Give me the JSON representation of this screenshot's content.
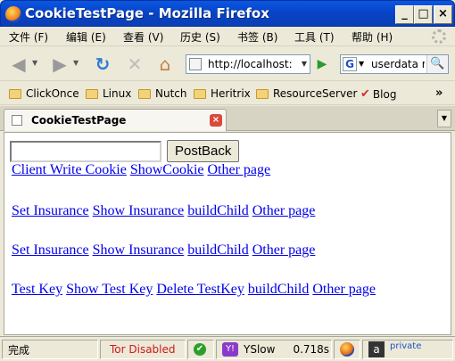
{
  "window": {
    "title": "CookieTestPage - Mozilla Firefox",
    "min_glyph": "_",
    "max_glyph": "□",
    "close_glyph": "×"
  },
  "menu": [
    "文件 (F)",
    "编辑 (E)",
    "查看 (V)",
    "历史 (S)",
    "书签 (B)",
    "工具 (T)",
    "帮助 (H)"
  ],
  "nav": {
    "back_icon": "◀",
    "forward_icon": "▶",
    "reload_icon": "↻",
    "stop_icon": "✕",
    "home_icon": "⌂",
    "url": "http://localhost:",
    "url_drop": "▼",
    "go_icon": "▶",
    "search_engine": "G",
    "search_text": "userdata r",
    "search_go": "🔍"
  },
  "bookmarks": [
    "ClickOnce",
    "Linux",
    "Nutch",
    "Heritrix",
    "ResourceServer",
    "Blog"
  ],
  "bookmarks_more": "»",
  "tab": {
    "label": "CookieTestPage",
    "close": "×",
    "list_btn": "▼"
  },
  "page": {
    "input_value": "",
    "postback_label": "PostBack",
    "row1": [
      "Client Write Cookie",
      "ShowCookie",
      "Other page"
    ],
    "row2": [
      "Set Insurance",
      "Show Insurance",
      "buildChild",
      "Other page"
    ],
    "row3": [
      "Set Insurance",
      "Show Insurance",
      "buildChild",
      "Other page"
    ],
    "row4": [
      "Test Key",
      "Show Test Key",
      "Delete TestKey",
      "buildChild",
      "Other page"
    ]
  },
  "status": {
    "done": "完成",
    "tor": "Tor Disabled",
    "ok": "✔",
    "yslow_label": "YSlow",
    "yslow_time": "0.718s",
    "private": "private"
  }
}
